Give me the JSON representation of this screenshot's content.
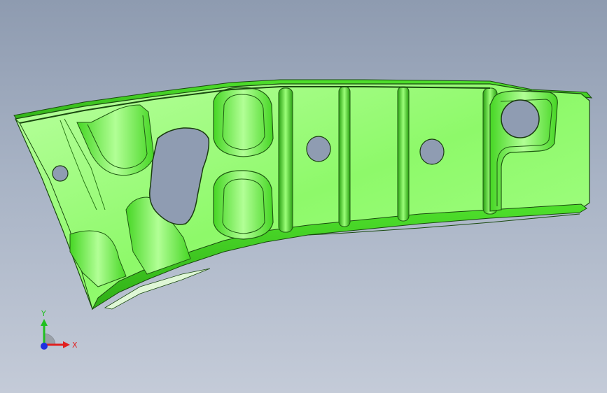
{
  "viewport": {
    "model": "sheet-metal-bracket",
    "part_color": "#7fff5a"
  },
  "triad": {
    "x_label": "X",
    "y_label": "Y",
    "x_color": "#e02020",
    "y_color": "#20c020",
    "z_color": "#2030e0"
  }
}
